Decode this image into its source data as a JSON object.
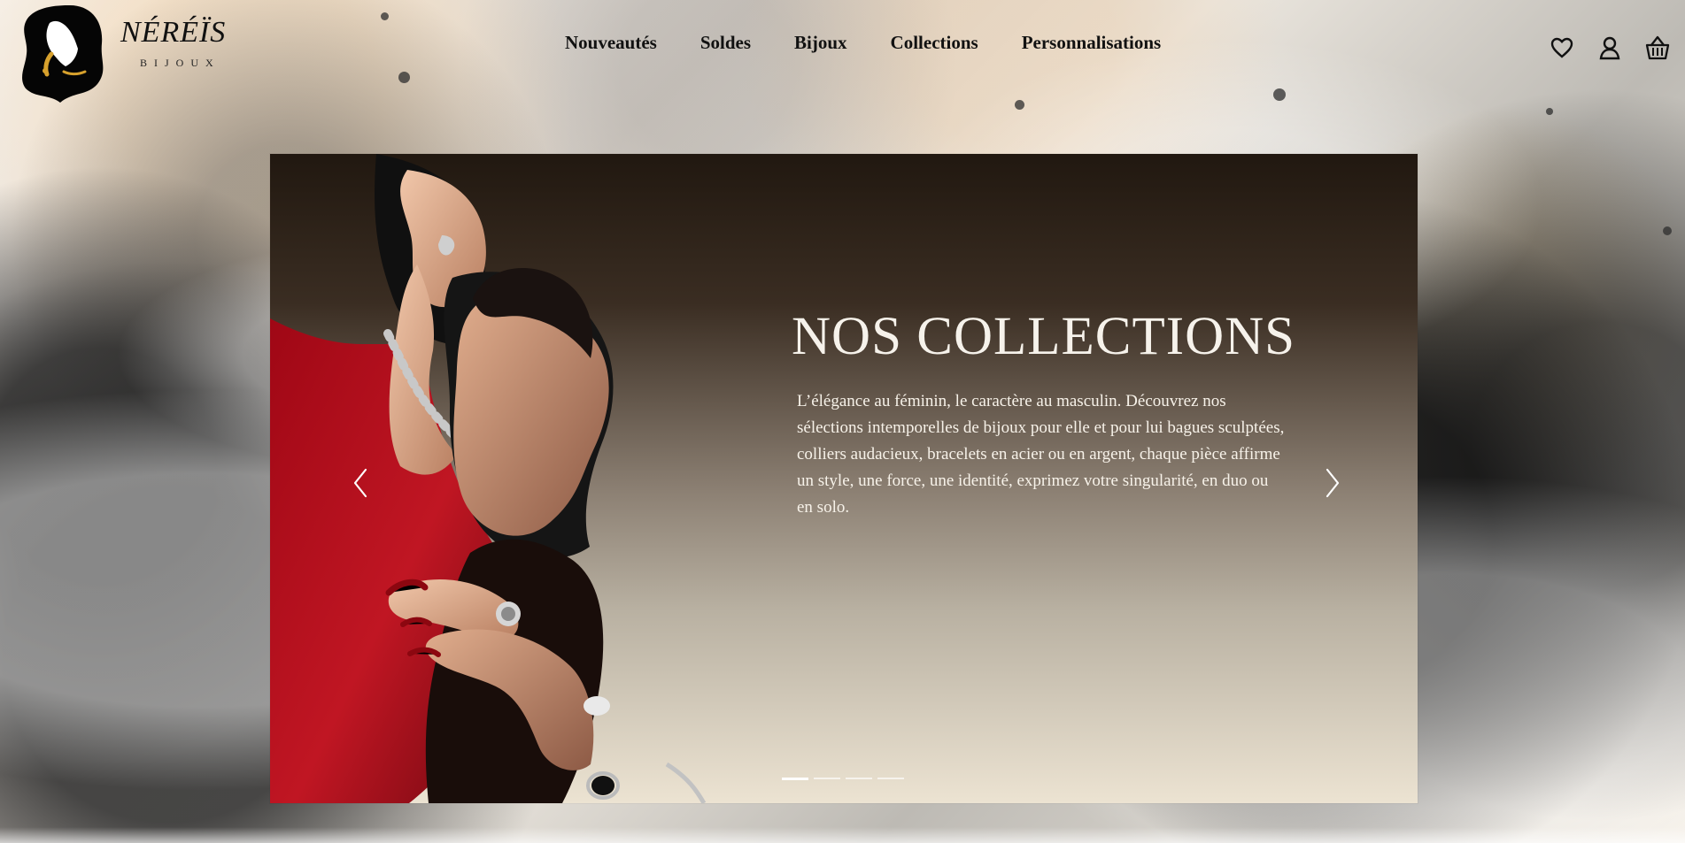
{
  "brand": {
    "name": "NÉRÉÏS",
    "subtitle": "BIJOUX"
  },
  "nav": {
    "items": [
      {
        "label": "Nouveautés"
      },
      {
        "label": "Soldes"
      },
      {
        "label": "Bijoux"
      },
      {
        "label": "Collections"
      },
      {
        "label": "Personnalisations"
      }
    ]
  },
  "header_icons": [
    {
      "name": "heart-icon"
    },
    {
      "name": "user-icon"
    },
    {
      "name": "shopping-basket-icon"
    }
  ],
  "hero": {
    "title": "NOS COLLECTIONS",
    "text": "L’élégance au féminin, le caractère au masculin. Découvrez nos sélections intemporelles de bijoux pour elle et pour lui bagues sculptées, colliers audacieux, bracelets en acier ou en argent, chaque pièce affirme un style, une force, une identité, exprimez votre singularité, en duo ou en solo.",
    "carousel": {
      "active_slide": 1,
      "slide_count": 4
    }
  },
  "colors": {
    "text_dark": "#111111",
    "hero_text": "#f6f2eb",
    "accent_red": "#b50f1c",
    "gold": "#d7a12d"
  }
}
